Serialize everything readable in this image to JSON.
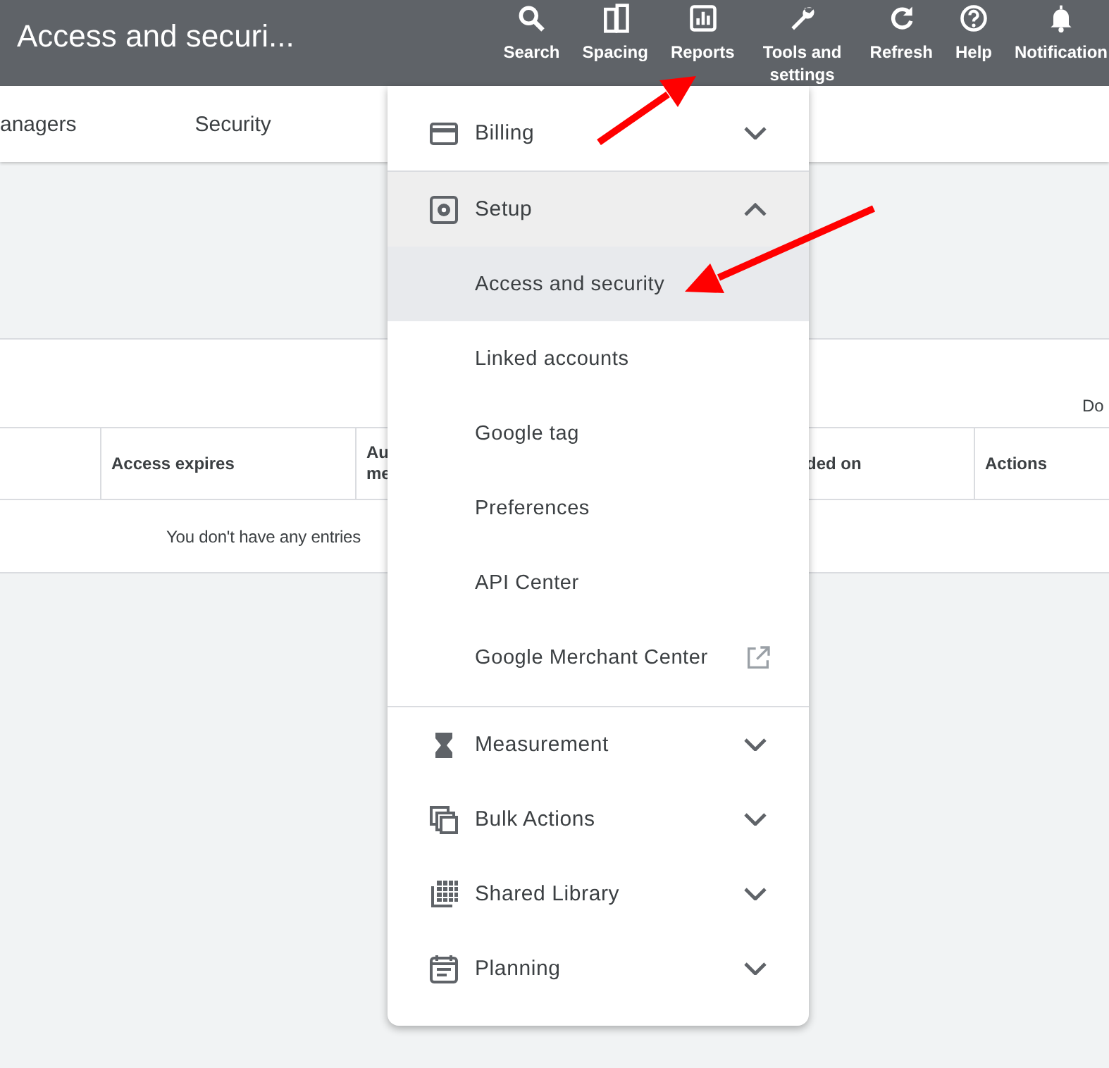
{
  "header": {
    "title": "Access and securi...",
    "nav_items": [
      "Search",
      "Spacing",
      "Reports",
      "Tools and settings",
      "Refresh",
      "Help",
      "Notification"
    ]
  },
  "tabs": [
    "anagers",
    "Security"
  ],
  "panel": {
    "corner_label": "Do",
    "columns": [
      "",
      "Access expires",
      "Au\nme",
      "ded on",
      "Actions"
    ],
    "empty_message": "You don't have any entries"
  },
  "menu": {
    "sections": [
      {
        "label": "Billing",
        "expanded": false
      },
      {
        "label": "Setup",
        "expanded": true,
        "children": [
          {
            "label": "Access and security",
            "selected": true,
            "external": false
          },
          {
            "label": "Linked accounts",
            "selected": false,
            "external": false
          },
          {
            "label": "Google tag",
            "selected": false,
            "external": false
          },
          {
            "label": "Preferences",
            "selected": false,
            "external": false
          },
          {
            "label": "API Center",
            "selected": false,
            "external": false
          },
          {
            "label": "Google Merchant Center",
            "selected": false,
            "external": true
          }
        ]
      },
      {
        "label": "Measurement",
        "expanded": false
      },
      {
        "label": "Bulk Actions",
        "expanded": false
      },
      {
        "label": "Shared Library",
        "expanded": false
      },
      {
        "label": "Planning",
        "expanded": false
      }
    ]
  }
}
